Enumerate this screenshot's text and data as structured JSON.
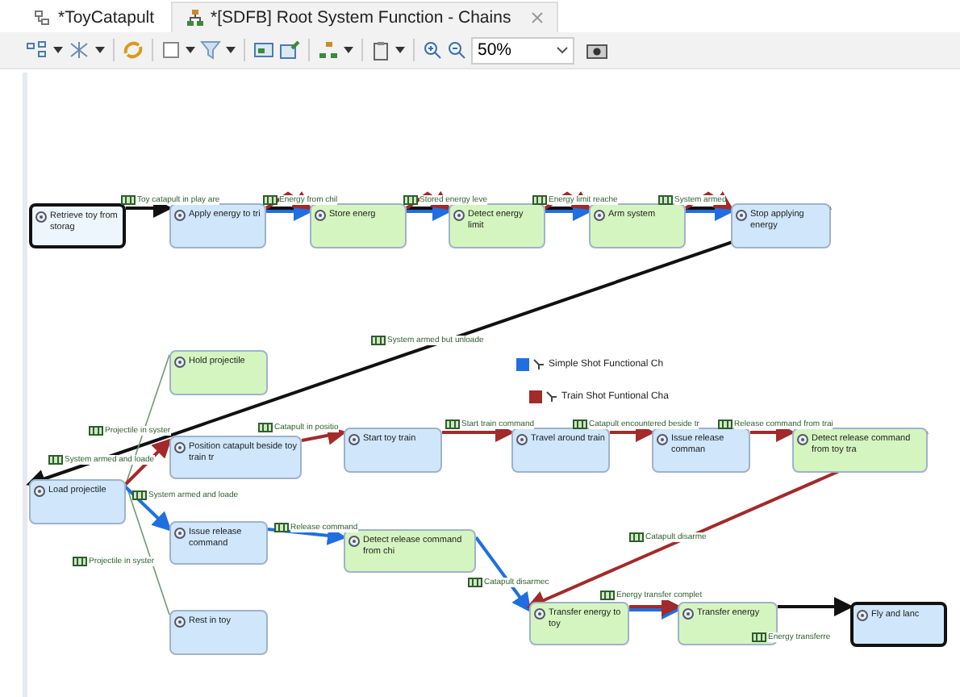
{
  "tabs": [
    {
      "label": "*ToyCatapult",
      "selected": false
    },
    {
      "label": "*[SDFB] Root System Function - Chains",
      "selected": true
    }
  ],
  "toolbar": {
    "zoom": "50%"
  },
  "diagram": {
    "nodes": [
      {
        "label": "Retrieve toy from storag",
        "color": "#eef6fd",
        "highlighted": true
      },
      {
        "label": "Apply energy to tri",
        "color": "#cfe6fb",
        "highlighted": false
      },
      {
        "label": "Store energ",
        "color": "#d5f5c0",
        "highlighted": false
      },
      {
        "label": "Detect energy limit",
        "color": "#d5f5c0",
        "highlighted": false
      },
      {
        "label": "Arm system",
        "color": "#d5f5c0",
        "highlighted": false
      },
      {
        "label": "Stop applying energy",
        "color": "#cfe6fb",
        "highlighted": false
      },
      {
        "label": "Hold projectile",
        "color": "#d5f5c0",
        "highlighted": false
      },
      {
        "label": "Position catapult beside toy train tr",
        "color": "#cfe6fb",
        "highlighted": false
      },
      {
        "label": "Start toy train",
        "color": "#cfe6fb",
        "highlighted": false
      },
      {
        "label": "Travel around train",
        "color": "#cfe6fb",
        "highlighted": false
      },
      {
        "label": "Issue release comman",
        "color": "#cfe6fb",
        "highlighted": false
      },
      {
        "label": "Detect release command from toy tra",
        "color": "#d5f5c0",
        "highlighted": false
      },
      {
        "label": "Load projectile",
        "color": "#cfe6fb",
        "highlighted": false
      },
      {
        "label": "Issue release command",
        "color": "#cfe6fb",
        "highlighted": false
      },
      {
        "label": "Detect release command from chi",
        "color": "#d5f5c0",
        "highlighted": false
      },
      {
        "label": "Rest in toy",
        "color": "#cfe6fb",
        "highlighted": false
      },
      {
        "label": "Transfer energy to toy",
        "color": "#d5f5c0",
        "highlighted": false
      },
      {
        "label": "Transfer energy",
        "color": "#d5f5c0",
        "highlighted": false
      },
      {
        "label": "Fly and lanc",
        "color": "#cfe6fb",
        "highlighted": true
      }
    ],
    "exchange_labels": [
      "Toy catapult in play are",
      "Energy from chil",
      "Stored energy leve",
      "Energy limit reache",
      "System armed",
      "System armed but unloade",
      "Projectile in syster",
      "System armed and loade",
      "Catapult in positio",
      "Start train command",
      "Catapult encountered beside tr",
      "Release command from trai",
      "System armed and loade",
      "Release command",
      "Projectile in syster",
      "Catapult disarmec",
      "Catapult disarme",
      "Energy transfer complet",
      "Energy transferre"
    ],
    "legend": [
      {
        "label": "Simple Shot Functional Ch",
        "color": "#1f6fe0"
      },
      {
        "label": "Train Shot Funtional Cha",
        "color": "#a32a2a"
      }
    ]
  }
}
